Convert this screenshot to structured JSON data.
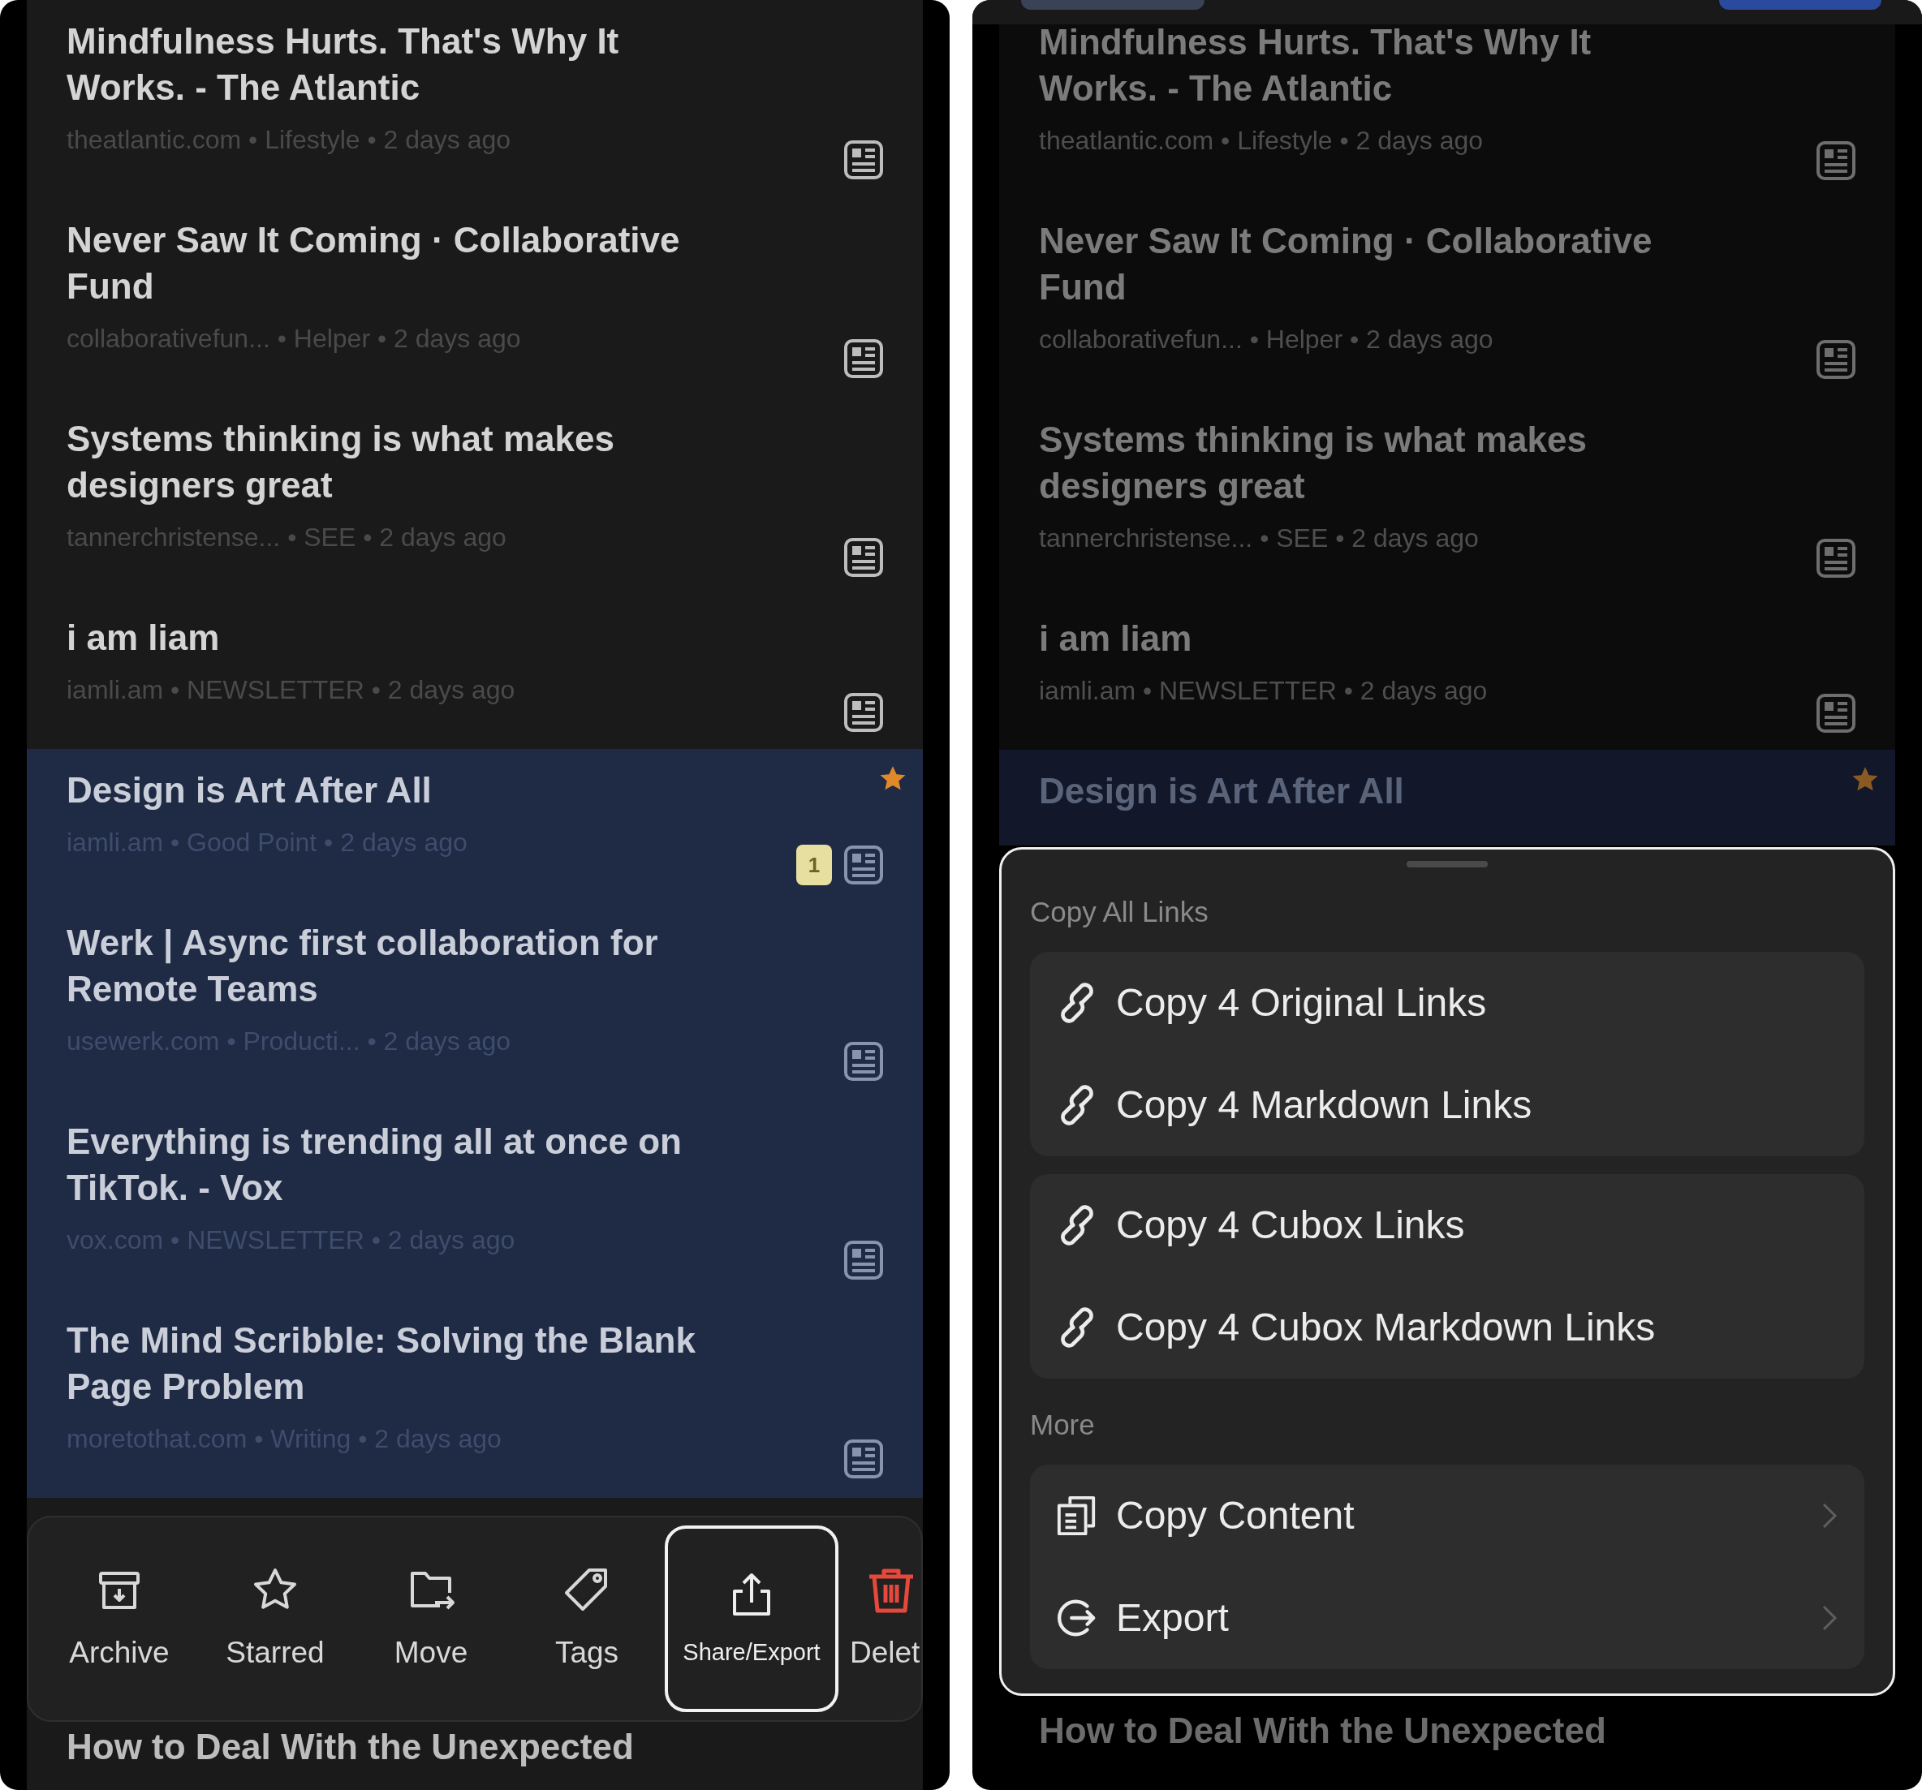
{
  "left_screen": {
    "articles": [
      {
        "title": "Mindfulness Hurts. That's Why It Works. - The Atlantic",
        "meta": "theatlantic.com • Lifestyle • 2 days ago",
        "selected": false,
        "starred": false
      },
      {
        "title": "Never Saw It Coming · Collaborative Fund",
        "meta": "collaborativefun... • Helper • 2 days ago",
        "selected": false,
        "starred": false
      },
      {
        "title": "Systems thinking is what makes designers great",
        "meta": "tannerchristense... • SEE • 2 days ago",
        "selected": false,
        "starred": false
      },
      {
        "title": "i am liam",
        "meta": "iamli.am • NEWSLETTER • 2 days ago",
        "selected": false,
        "starred": false
      },
      {
        "title": "Design is Art After All",
        "meta": "iamli.am • Good Point • 2 days ago",
        "selected": true,
        "starred": true,
        "highlights": "1"
      },
      {
        "title": "Werk | Async first collaboration for Remote Teams",
        "meta": "usewerk.com • Producti... • 2 days ago",
        "selected": true,
        "starred": false
      },
      {
        "title": "Everything is trending all at once on TikTok. - Vox",
        "meta": "vox.com • NEWSLETTER • 2 days ago",
        "selected": true,
        "starred": false
      },
      {
        "title": "The Mind Scribble: Solving the Blank Page Problem",
        "meta": "moretothat.com • Writing • 2 days ago",
        "selected": true,
        "starred": false
      }
    ],
    "toolbar": [
      {
        "kind": "archive",
        "label": "Archive",
        "selected": false
      },
      {
        "kind": "star",
        "label": "Starred",
        "selected": false
      },
      {
        "kind": "move",
        "label": "Move",
        "selected": false
      },
      {
        "kind": "tags",
        "label": "Tags",
        "selected": false
      },
      {
        "kind": "share",
        "label": "Share/Export",
        "selected": true
      },
      {
        "kind": "delete",
        "label": "Delet",
        "selected": false
      }
    ],
    "next_article": {
      "title": "How to Deal With the Unexpected"
    }
  },
  "right_screen": {
    "articles": [
      {
        "title": "Mindfulness Hurts. That's Why It Works. - The Atlantic",
        "meta": "theatlantic.com • Lifestyle • 2 days ago",
        "selected": false,
        "starred": false
      },
      {
        "title": "Never Saw It Coming · Collaborative Fund",
        "meta": "collaborativefun... • Helper • 2 days ago",
        "selected": false,
        "starred": false
      },
      {
        "title": "Systems thinking is what makes designers great",
        "meta": "tannerchristense... • SEE • 2 days ago",
        "selected": false,
        "starred": false
      },
      {
        "title": "i am liam",
        "meta": "iamli.am • NEWSLETTER • 2 days ago",
        "selected": false,
        "starred": false
      },
      {
        "title": "Design is Art After All",
        "selected": true,
        "starred": true
      }
    ],
    "sheet": {
      "sections": [
        {
          "title": "Copy All Links",
          "groups": [
            [
              {
                "kind": "link",
                "label": "Copy 4 Original Links",
                "submenu": false
              },
              {
                "kind": "link",
                "label": "Copy 4 Markdown Links",
                "submenu": false
              }
            ],
            [
              {
                "kind": "link",
                "label": "Copy 4 Cubox Links",
                "submenu": false
              },
              {
                "kind": "link",
                "label": "Copy 4 Cubox Markdown Links",
                "submenu": false
              }
            ]
          ]
        },
        {
          "title": "More",
          "groups": [
            [
              {
                "kind": "copy",
                "label": "Copy Content",
                "submenu": true
              },
              {
                "kind": "export",
                "label": "Export",
                "submenu": true
              }
            ]
          ]
        }
      ]
    },
    "next_article": {
      "title": "How to Deal With the Unexpected"
    }
  }
}
